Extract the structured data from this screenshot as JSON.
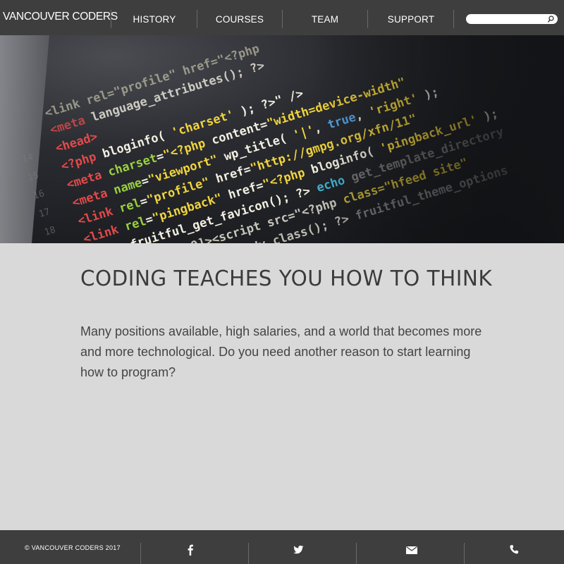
{
  "nav": {
    "brand": "VANCOUVER CODERS",
    "items": [
      {
        "label": "HISTORY"
      },
      {
        "label": "COURSES"
      },
      {
        "label": "TEAM"
      },
      {
        "label": "SUPPORT"
      }
    ],
    "search": {
      "value": "",
      "icon": "search-icon"
    }
  },
  "hero": {
    "image": "code-editor-photo"
  },
  "main": {
    "headline": "CODING TEACHES YOU HOW TO THINK",
    "intro": "Many positions available, high salaries, and a world that becomes more and more technological. Do you need another reason to start learning how to program?"
  },
  "footer": {
    "copyright": "© VANCOUVER CODERS  2017",
    "icons": [
      "facebook-icon",
      "twitter-icon",
      "email-icon",
      "phone-icon"
    ]
  },
  "colors": {
    "nav_bg": "#3e3e3e",
    "page_bg": "#d9d9d9",
    "text": "#3b3b3b"
  }
}
